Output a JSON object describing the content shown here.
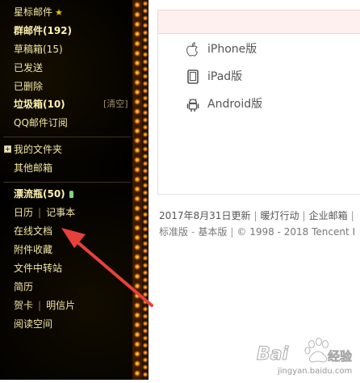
{
  "sidebar": {
    "items": [
      {
        "label": "星标邮件",
        "bold": false
      },
      {
        "label": "群邮件(192)",
        "bold": true
      },
      {
        "label": "草稿箱(15)",
        "bold": false
      },
      {
        "label": "已发送",
        "bold": false
      },
      {
        "label": "已删除",
        "bold": false
      },
      {
        "label": "垃圾箱(10)",
        "bold": true
      },
      {
        "label": "QQ邮件订阅",
        "bold": false
      },
      {
        "label": "我的文件夹",
        "bold": false
      },
      {
        "label": "其他邮箱",
        "bold": false
      },
      {
        "label": "漂流瓶(50)",
        "bold": true
      },
      {
        "label": "日历",
        "second": "记事本"
      },
      {
        "label": "在线文档"
      },
      {
        "label": "附件收藏"
      },
      {
        "label": "文件中转站"
      },
      {
        "label": "简历"
      },
      {
        "label": "贺卡",
        "second": "明信片"
      },
      {
        "label": "阅读空间"
      }
    ],
    "clear_label": "[清空]",
    "star_icon": "star-icon",
    "expand_icon": "+"
  },
  "apps": [
    {
      "label": "iPhone版",
      "icon": "apple-icon"
    },
    {
      "label": "iPad版",
      "icon": "tablet-icon"
    },
    {
      "label": "Android版",
      "icon": "android-icon"
    }
  ],
  "footer": {
    "line1": [
      "2017年8月31日更新",
      "暖灯行动",
      "企业邮箱",
      "…"
    ],
    "line2": [
      "标准版",
      "基本版",
      "© 1998 - 2018 Tencent I"
    ],
    "separator": "|",
    "dash": "-"
  },
  "watermark": {
    "brand": "Bai",
    "brand_tail": "经验",
    "url": "jingyan.baidu.com"
  },
  "colors": {
    "sidebar_bg": "#000000",
    "sidebar_text": "#f3e6a3",
    "arrow": "#e8413a",
    "header_band": "#fdf0ef"
  }
}
